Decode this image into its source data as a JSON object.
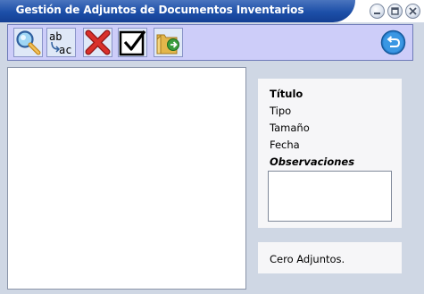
{
  "window": {
    "title": "Gestión de Adjuntos de Documentos Inventarios",
    "controls": [
      "minimize-icon",
      "maximize-icon",
      "close-icon"
    ]
  },
  "toolbar": {
    "buttons": [
      {
        "name": "search",
        "icon": "magnifier-icon"
      },
      {
        "name": "rename",
        "icon": "ab-ac-rename-icon"
      },
      {
        "name": "delete",
        "icon": "red-x-icon"
      },
      {
        "name": "accept",
        "icon": "checkbox-check-icon"
      },
      {
        "name": "open-folder",
        "icon": "folder-arrow-icon"
      },
      {
        "name": "back",
        "icon": "undo-arrow-icon"
      }
    ]
  },
  "details": {
    "titulo_label": "Título",
    "tipo_label": "Tipo",
    "tamano_label": "Tamaño",
    "fecha_label": "Fecha",
    "observaciones_label": "Observaciones",
    "observaciones_value": ""
  },
  "status": {
    "text": "Cero Adjuntos."
  },
  "colors": {
    "titlebar": "#1c4fa8",
    "toolbar_bg": "#cdcdf9",
    "window_bg": "#cfd7e4",
    "panel_bg": "#f6f6f8"
  }
}
